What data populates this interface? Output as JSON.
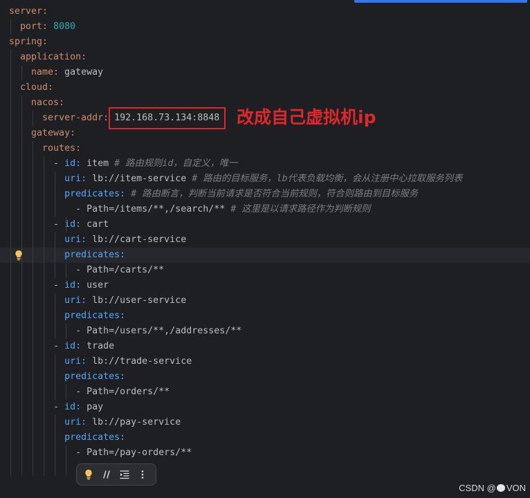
{
  "editor": {
    "language": "yaml",
    "lines": [
      {
        "indent": 0,
        "tokens": [
          {
            "t": "server:",
            "c": "key"
          }
        ]
      },
      {
        "indent": 2,
        "tokens": [
          {
            "t": "port:",
            "c": "key"
          },
          {
            "t": "8080",
            "c": "number"
          }
        ]
      },
      {
        "indent": 0,
        "tokens": [
          {
            "t": "spring:",
            "c": "key"
          }
        ]
      },
      {
        "indent": 2,
        "tokens": [
          {
            "t": "application:",
            "c": "key"
          }
        ]
      },
      {
        "indent": 4,
        "tokens": [
          {
            "t": "name:",
            "c": "key"
          },
          {
            "t": "gateway",
            "c": "value"
          }
        ]
      },
      {
        "indent": 2,
        "tokens": [
          {
            "t": "cloud:",
            "c": "key"
          }
        ]
      },
      {
        "indent": 4,
        "tokens": [
          {
            "t": "nacos:",
            "c": "key"
          }
        ]
      },
      {
        "indent": 6,
        "tokens": [
          {
            "t": "server-addr:",
            "c": "key"
          },
          {
            "t": "192.168.73.134:8848",
            "c": "value",
            "highlighted": true
          }
        ]
      },
      {
        "indent": 4,
        "tokens": [
          {
            "t": "gateway:",
            "c": "key"
          }
        ]
      },
      {
        "indent": 6,
        "tokens": [
          {
            "t": "routes:",
            "c": "key"
          }
        ]
      },
      {
        "indent": 8,
        "tokens": [
          {
            "t": "-",
            "c": "dash"
          },
          {
            "t": "id:",
            "c": "key-item"
          },
          {
            "t": "item",
            "c": "value"
          },
          {
            "t": "# 路由规则id，自定义，唯一",
            "c": "comment"
          }
        ]
      },
      {
        "indent": 10,
        "tokens": [
          {
            "t": "uri:",
            "c": "key-item"
          },
          {
            "t": "lb://item-service",
            "c": "value"
          },
          {
            "t": "# 路由的目标服务，lb代表负载均衡，会从注册中心拉取服务列表",
            "c": "comment"
          }
        ]
      },
      {
        "indent": 10,
        "tokens": [
          {
            "t": "predicates:",
            "c": "key-item"
          },
          {
            "t": "# 路由断言，判断当前请求是否符合当前规则，符合则路由到目标服务",
            "c": "comment"
          }
        ]
      },
      {
        "indent": 12,
        "tokens": [
          {
            "t": "-",
            "c": "dash"
          },
          {
            "t": "Path=/items/**,/search/**",
            "c": "value"
          },
          {
            "t": "# 这里是以请求路径作为判断规则",
            "c": "comment"
          }
        ]
      },
      {
        "indent": 8,
        "tokens": [
          {
            "t": "-",
            "c": "dash"
          },
          {
            "t": "id:",
            "c": "key-item"
          },
          {
            "t": "cart",
            "c": "value"
          }
        ]
      },
      {
        "indent": 10,
        "tokens": [
          {
            "t": "uri:",
            "c": "key-item"
          },
          {
            "t": "lb://cart-service",
            "c": "value"
          }
        ]
      },
      {
        "indent": 10,
        "current": true,
        "tokens": [
          {
            "t": "predicates:",
            "c": "key-item"
          }
        ]
      },
      {
        "indent": 12,
        "tokens": [
          {
            "t": "-",
            "c": "dash"
          },
          {
            "t": "Path=/carts/**",
            "c": "value"
          }
        ]
      },
      {
        "indent": 8,
        "tokens": [
          {
            "t": "-",
            "c": "dash"
          },
          {
            "t": "id:",
            "c": "key-item"
          },
          {
            "t": "user",
            "c": "value"
          }
        ]
      },
      {
        "indent": 10,
        "tokens": [
          {
            "t": "uri:",
            "c": "key-item"
          },
          {
            "t": "lb://user-service",
            "c": "value"
          }
        ]
      },
      {
        "indent": 10,
        "tokens": [
          {
            "t": "predicates:",
            "c": "key-item"
          }
        ]
      },
      {
        "indent": 12,
        "tokens": [
          {
            "t": "-",
            "c": "dash"
          },
          {
            "t": "Path=/users/**,/addresses/**",
            "c": "value"
          }
        ]
      },
      {
        "indent": 8,
        "tokens": [
          {
            "t": "-",
            "c": "dash"
          },
          {
            "t": "id:",
            "c": "key-item"
          },
          {
            "t": "trade",
            "c": "value"
          }
        ]
      },
      {
        "indent": 10,
        "tokens": [
          {
            "t": "uri:",
            "c": "key-item"
          },
          {
            "t": "lb://trade-service",
            "c": "value"
          }
        ]
      },
      {
        "indent": 10,
        "tokens": [
          {
            "t": "predicates:",
            "c": "key-item"
          }
        ]
      },
      {
        "indent": 12,
        "tokens": [
          {
            "t": "-",
            "c": "dash"
          },
          {
            "t": "Path=/orders/**",
            "c": "value"
          }
        ]
      },
      {
        "indent": 8,
        "tokens": [
          {
            "t": "-",
            "c": "dash"
          },
          {
            "t": "id:",
            "c": "key-item"
          },
          {
            "t": "pay",
            "c": "value"
          }
        ]
      },
      {
        "indent": 10,
        "tokens": [
          {
            "t": "uri:",
            "c": "key-item"
          },
          {
            "t": "lb://pay-service",
            "c": "value"
          }
        ]
      },
      {
        "indent": 10,
        "tokens": [
          {
            "t": "predicates:",
            "c": "key-item"
          }
        ]
      },
      {
        "indent": 12,
        "tokens": [
          {
            "t": "-",
            "c": "dash"
          },
          {
            "t": "Path=/pay-orders/**",
            "c": "value"
          }
        ]
      }
    ]
  },
  "annotation": {
    "label": "改成自己虚拟机ip"
  },
  "gutter": {
    "intention_icon": "lightbulb-icon"
  },
  "floating_toolbar": {
    "items": [
      {
        "icon": "lightbulb-icon"
      },
      {
        "icon": "comment-icon"
      },
      {
        "icon": "indent-icon"
      },
      {
        "icon": "more-icon"
      }
    ]
  },
  "watermark": {
    "prefix": "CSDN @",
    "icon": "avatar-icon",
    "suffix": "VON"
  },
  "colors": {
    "background": "#1e1f22",
    "key": "#cf8e6d",
    "key_item": "#56a8f5",
    "number": "#2aacb8",
    "text": "#bcbec4",
    "comment": "#7a7e85",
    "annotation": "#e0272b",
    "accent": "#3574f0",
    "lightbulb": "#f2c55c",
    "current_line": "#26282e",
    "indent_guide": "#393b40",
    "toolbar_bg": "#2b2d30"
  }
}
